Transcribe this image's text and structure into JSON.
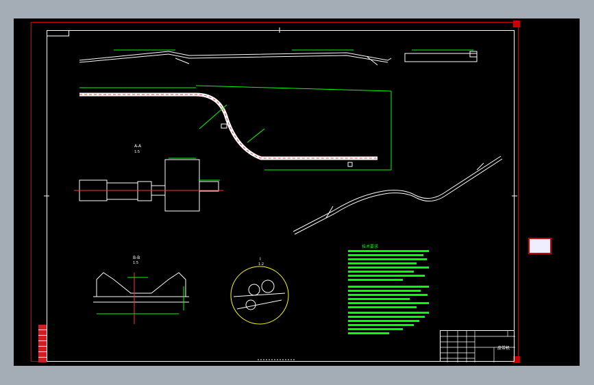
{
  "title_block": {
    "name": "皮带机"
  },
  "views": {
    "section_a": "A-A",
    "section_a_scale": "1:5",
    "section_b": "B-B",
    "section_b_scale": "1:5",
    "detail_c": "I",
    "detail_c_scale": "1:2"
  },
  "notes": {
    "heading": "技术要求"
  },
  "colors": {
    "background": "#000000",
    "frame": "#cc0000",
    "lines": "#ffffff",
    "dimensions": "#00ff00",
    "center_line": "#ff3333"
  }
}
